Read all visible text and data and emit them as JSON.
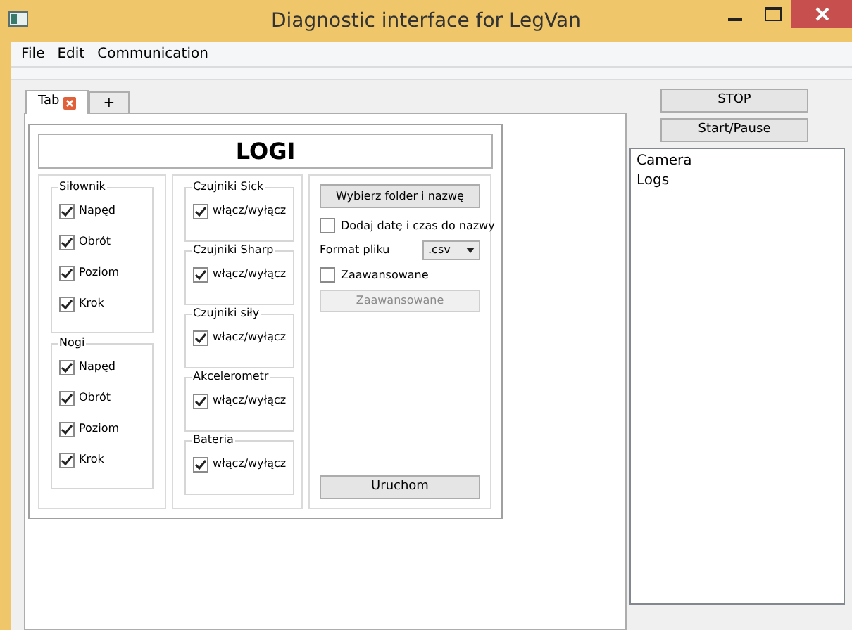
{
  "window": {
    "title": "Diagnostic interface for LegVan"
  },
  "menu": [
    "File",
    "Edit",
    "Communication"
  ],
  "tabs": [
    {
      "label": "Tab",
      "selected": true,
      "closable": true
    },
    {
      "label": "+",
      "selected": false,
      "closable": false
    }
  ],
  "panel": {
    "title": "LOGI",
    "actuator_groups": [
      {
        "title": "Siłownik",
        "items": [
          {
            "label": "Napęd",
            "checked": true
          },
          {
            "label": "Obrót",
            "checked": true
          },
          {
            "label": "Poziom",
            "checked": true
          },
          {
            "label": "Krok",
            "checked": true
          }
        ]
      },
      {
        "title": "Nogi",
        "items": [
          {
            "label": "Napęd",
            "checked": true
          },
          {
            "label": "Obrót",
            "checked": true
          },
          {
            "label": "Poziom",
            "checked": true
          },
          {
            "label": "Krok",
            "checked": true
          }
        ]
      }
    ],
    "sensor_groups": [
      {
        "title": "Czujniki Sick",
        "items": [
          {
            "label": "włącz/wyłącz",
            "checked": true
          }
        ]
      },
      {
        "title": "Czujniki Sharp",
        "items": [
          {
            "label": "włącz/wyłącz",
            "checked": true
          }
        ]
      },
      {
        "title": "Czujniki siły",
        "items": [
          {
            "label": "włącz/wyłącz",
            "checked": true
          }
        ]
      },
      {
        "title": "Akcelerometr",
        "items": [
          {
            "label": "włącz/wyłącz",
            "checked": true
          }
        ]
      },
      {
        "title": "Bateria",
        "items": [
          {
            "label": "włącz/wyłącz",
            "checked": true
          }
        ]
      }
    ],
    "options": [
      {
        "kind": "button",
        "label": "Wybierz folder i nazwę",
        "disabled": false
      },
      {
        "kind": "checkbox",
        "label": "Dodaj datę i czas do nazwy",
        "checked": false
      },
      {
        "kind": "select",
        "label": "Format pliku",
        "value": ".csv"
      },
      {
        "kind": "checkbox",
        "label": "Zaawansowane",
        "checked": false
      },
      {
        "kind": "button",
        "label": "Zaawansowane",
        "disabled": true
      }
    ],
    "run_button": "Uruchom"
  },
  "controls": [
    "STOP",
    "Start/Pause"
  ],
  "list": [
    "Camera",
    "Logs"
  ]
}
